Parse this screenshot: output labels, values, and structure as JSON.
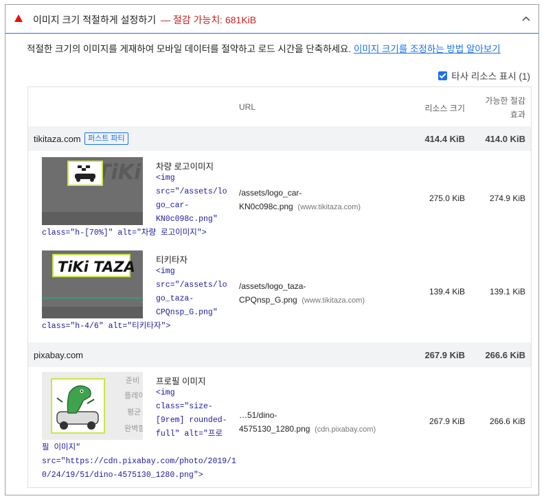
{
  "audit": {
    "title": "이미지 크기 적절하게 설정하기",
    "savings": "— 절감 가능치: 681KiB",
    "description": "적절한 크기의 이미지를 게재하여 모바일 데이터를 절약하고 로드 시간을 단축하세요.",
    "learn_more": "이미지 크기를 조정하는 방법 알아보기",
    "third_party_label": "타사 리소스 표시 (1)",
    "third_party_checked": true
  },
  "table": {
    "headers": {
      "url": "URL",
      "resource_size": "리소스 크기",
      "savings_line1": "가능한 절감",
      "savings_line2": "효과"
    },
    "groups": [
      {
        "name": "tikitaza.com",
        "badge": "퍼스트 파티",
        "size": "414.4 KiB",
        "saving": "414.0 KiB",
        "items": [
          {
            "label": "차량 로고이미지",
            "code_lines": [
              "<img",
              "src=\"/assets/lo",
              "go_car-",
              "KN0c098c.png\""
            ],
            "code_tail": "class=\"h-[70%]\" alt=\"차량 로고이미지\">",
            "url_line1": "/assets/logo_car-",
            "url_line2": "KN0c098c.png",
            "host": "(www.tikitaza.com)",
            "size": "275.0 KiB",
            "saving": "274.9 KiB"
          },
          {
            "label": "티키타자",
            "code_lines": [
              "<img",
              "src=\"/assets/lo",
              "go_taza-",
              "CPQnsp_G.png\""
            ],
            "code_tail": "class=\"h-4/6\" alt=\"티키타자\">",
            "url_line1": "/assets/logo_taza-",
            "url_line2": "CPQnsp_G.png",
            "host": "(www.tikitaza.com)",
            "size": "139.4 KiB",
            "saving": "139.1 KiB"
          }
        ]
      },
      {
        "name": "pixabay.com",
        "size": "267.9 KiB",
        "saving": "266.6 KiB",
        "items": [
          {
            "label": "프로필 이미지",
            "code_lines": [
              "<img",
              "class=\"size-",
              "[9rem] rounded-",
              "full\" alt=\"프로"
            ],
            "code_tail_lines": [
              "필 이미지\"",
              "src=\"https://cdn.pixabay.com/photo/2019/1",
              "0/24/19/51/dino-4575130_1280.png\">"
            ],
            "url_line1": "…51/dino-",
            "url_line2": "4575130_1280.png",
            "host": "(cdn.pixabay.com)",
            "size": "267.9 KiB",
            "saving": "266.6 KiB"
          }
        ]
      }
    ],
    "thumb_texts": {
      "logo_text": "TiKi TAZA",
      "bg_words": [
        "준비",
        "플레이",
        "평균",
        "완벽함"
      ]
    }
  },
  "colors": {
    "fail": "#eb0f00",
    "accent": "#1a73e8",
    "code": "#1a1a9e",
    "group_bg": "#f1f3f4"
  }
}
